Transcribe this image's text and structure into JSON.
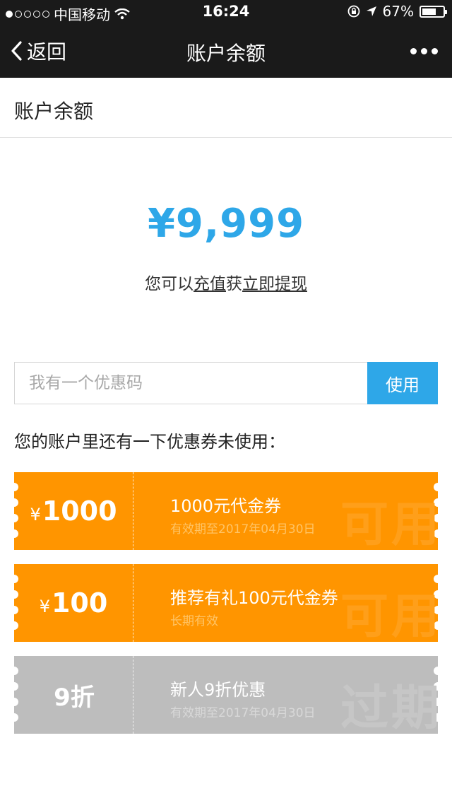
{
  "status_bar": {
    "carrier": "中国移动",
    "time": "16:24",
    "battery_percent": "67%",
    "battery_level": 0.67
  },
  "nav": {
    "back_label": "返回",
    "title": "账户余额"
  },
  "section": {
    "title": "账户余额"
  },
  "balance": {
    "amount": "¥9,999",
    "tip_prefix": "您可以",
    "tip_link_recharge": "充值",
    "tip_middle": "获",
    "tip_link_withdraw": "立即提现"
  },
  "promo": {
    "placeholder": "我有一个优惠码",
    "button_label": "使用"
  },
  "coupons_intro": "您的账户里还有一下优惠券未使用：",
  "coupons": [
    {
      "currency": "¥",
      "amount": "1000",
      "title": "1000元代金券",
      "validity": "有效期至2017年04月30日",
      "status": "可用",
      "color": "#ff9500"
    },
    {
      "currency": "¥",
      "amount": "100",
      "title": "推荐有礼100元代金券",
      "validity": "长期有效",
      "status": "可用",
      "color": "#ff9500"
    },
    {
      "currency": "",
      "amount": "9折",
      "title": "新人9折优惠",
      "validity": "有效期至2017年04月30日",
      "status": "过期",
      "color": "#bdbdbd"
    }
  ],
  "colors": {
    "accent": "#2ea7e8",
    "coupon_active": "#ff9500",
    "coupon_expired": "#bdbdbd",
    "bar": "#1a1a1a"
  }
}
